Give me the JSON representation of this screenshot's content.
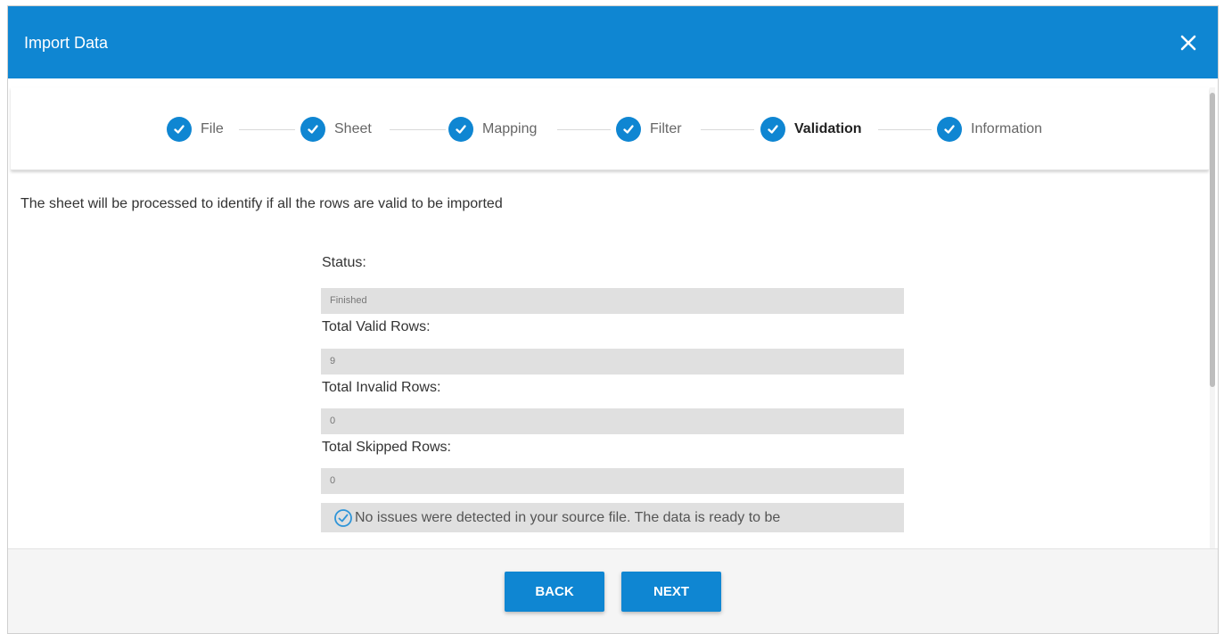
{
  "dialog": {
    "title": "Import Data",
    "accent_color": "#0f86d2"
  },
  "steps": [
    {
      "label": "File",
      "icon": "check-circle-icon",
      "done": true
    },
    {
      "label": "Sheet",
      "icon": "check-circle-icon",
      "done": true
    },
    {
      "label": "Mapping",
      "icon": "check-circle-icon",
      "done": true
    },
    {
      "label": "Filter",
      "icon": "check-circle-icon",
      "done": true
    },
    {
      "label": "Validation",
      "icon": "check-circle-icon",
      "done": true,
      "active": true
    },
    {
      "label": "Information",
      "icon": "check-circle-icon",
      "done": true
    }
  ],
  "content": {
    "description": "The sheet will be processed to identify if all the rows are valid to be imported",
    "fields": [
      {
        "label": "Status:",
        "value": "Finished"
      },
      {
        "label": "Total Valid Rows:",
        "value": "9"
      },
      {
        "label": "Total Invalid Rows:",
        "value": "0"
      },
      {
        "label": "Total Skipped Rows:",
        "value": "0"
      }
    ],
    "message": "No issues were detected in your source file. The data is ready to be"
  },
  "footer": {
    "back_label": "BACK",
    "next_label": "NEXT"
  }
}
